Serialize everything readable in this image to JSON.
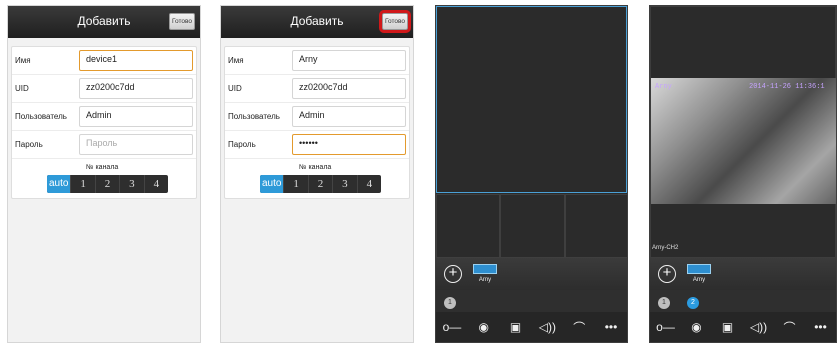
{
  "form1": {
    "title": "Добавить",
    "done_label": "Готово",
    "fields": [
      {
        "label": "Имя",
        "value": "device1"
      },
      {
        "label": "UID",
        "value": "zz0200c7dd"
      },
      {
        "label": "Пользователь",
        "value": "Admin"
      },
      {
        "label": "Пароль",
        "value": "Пароль"
      }
    ],
    "channel_label": "№ канала",
    "channels": [
      "auto",
      "1",
      "2",
      "3",
      "4"
    ]
  },
  "form2": {
    "title": "Добавить",
    "done_label": "Готово",
    "fields": [
      {
        "label": "Имя",
        "value": "Arny"
      },
      {
        "label": "UID",
        "value": "zz0200c7dd"
      },
      {
        "label": "Пользователь",
        "value": "Admin"
      },
      {
        "label": "Пароль",
        "value": "••••••"
      }
    ],
    "channel_label": "№ канала",
    "channels": [
      "auto",
      "1",
      "2",
      "3",
      "4"
    ]
  },
  "viewer1": {
    "camera_name": "Arny",
    "channel_dots": [
      "1"
    ]
  },
  "viewer2": {
    "camera_name": "Arny",
    "osd_name": "Arny",
    "osd_timestamp": "2014-11-26 11:36:1",
    "caption": "Arny-CH2",
    "channel_dots": [
      "1",
      "2"
    ]
  },
  "toolbar": {
    "key_icon": "key-icon",
    "camera_icon": "camera-icon",
    "video_icon": "video-icon",
    "speaker_icon": "speaker-icon",
    "phone_icon": "phone-icon",
    "more_icon": "more-icon",
    "glyphs": [
      "o—",
      "◉",
      "▣",
      "◁))",
      "⌒",
      "•••"
    ]
  },
  "colors": {
    "accent_blue": "#2e9ad8",
    "highlight_red": "#d0181a",
    "focus_orange": "#e39a2d"
  }
}
